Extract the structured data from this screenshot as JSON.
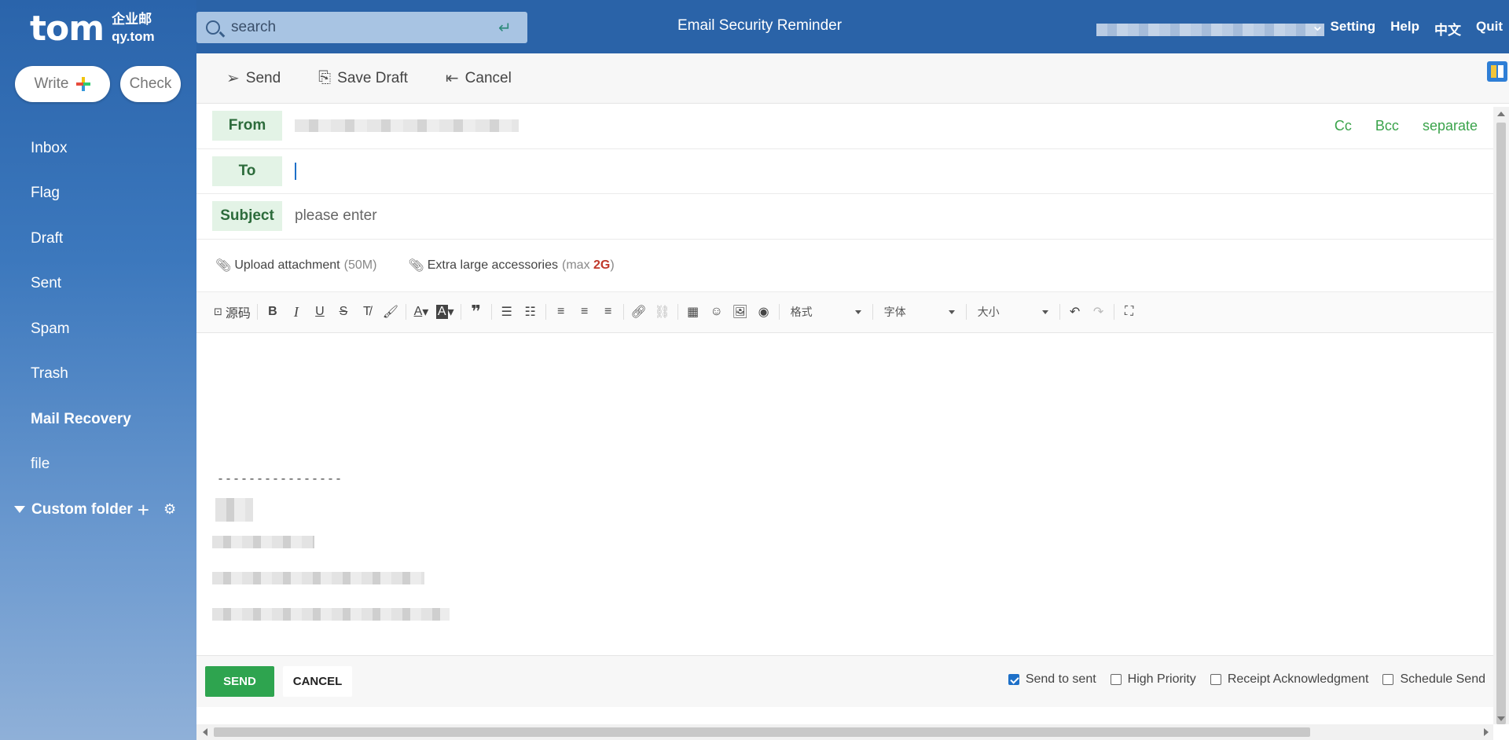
{
  "logo": {
    "main": "tom",
    "sub_cn": "企业邮",
    "sub_domain": "qy.tom"
  },
  "sidebar": {
    "write_label": "Write",
    "check_label": "Check",
    "items": [
      {
        "label": "Inbox"
      },
      {
        "label": "Flag"
      },
      {
        "label": "Draft"
      },
      {
        "label": "Sent"
      },
      {
        "label": "Spam"
      },
      {
        "label": "Trash"
      },
      {
        "label": "Mail Recovery"
      },
      {
        "label": "file"
      }
    ],
    "custom_folder_label": "Custom folder"
  },
  "topbar": {
    "search_placeholder": "search",
    "title": "Email Security Reminder",
    "links": {
      "setting": "Setting",
      "help": "Help",
      "lang": "中文",
      "quit": "Quit"
    }
  },
  "toolbar": {
    "send": "Send",
    "save_draft": "Save Draft",
    "cancel": "Cancel"
  },
  "compose": {
    "from_label": "From",
    "to_label": "To",
    "subject_label": "Subject",
    "subject_placeholder": "please enter",
    "cc": "Cc",
    "bcc": "Bcc",
    "separate": "separate"
  },
  "attachments": {
    "upload_label": "Upload attachment",
    "upload_limit": "(50M)",
    "large_label": "Extra large accessories",
    "large_limit_prefix": "(max",
    "large_limit_value": "2G",
    "large_limit_suffix": ")"
  },
  "editor": {
    "source_label": "源码",
    "format_label": "格式",
    "font_label": "字体",
    "size_label": "大小",
    "signature_separator": "----------------"
  },
  "footer": {
    "send": "SEND",
    "cancel": "CANCEL",
    "options": [
      {
        "label": "Send to sent",
        "checked": true
      },
      {
        "label": "High Priority",
        "checked": false
      },
      {
        "label": "Receipt Acknowledgment",
        "checked": false
      },
      {
        "label": "Schedule Send",
        "checked": false
      }
    ]
  },
  "colors": {
    "accent_green": "#2ea44f",
    "sidebar_blue": "#2f6bb1",
    "label_bg": "#e3f3e6",
    "link_green": "#3aa34b"
  }
}
